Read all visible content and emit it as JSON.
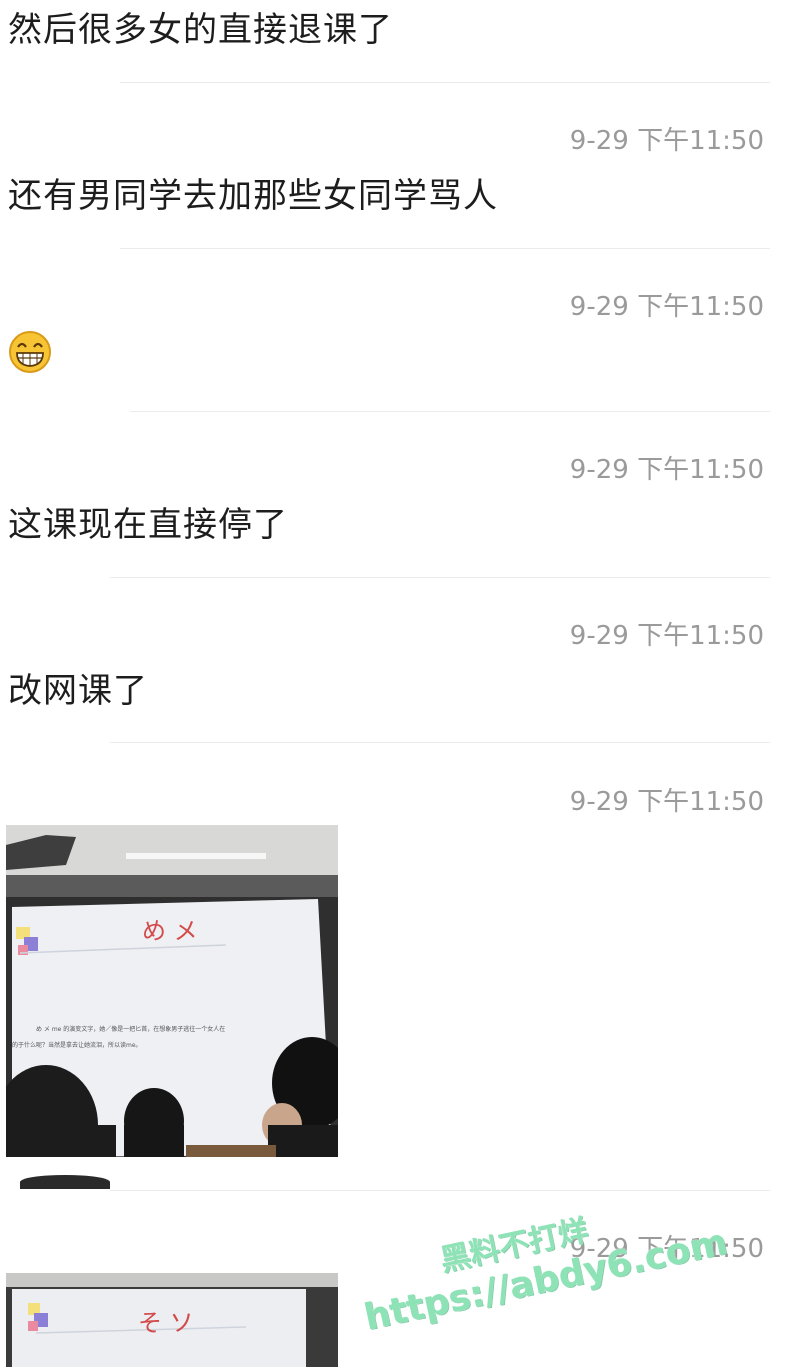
{
  "messages": [
    {
      "text": "然后很多女的直接退课了"
    },
    {
      "timestamp": "9-29 下午11:50",
      "text": "还有男同学去加那些女同学骂人"
    },
    {
      "timestamp": "9-29 下午11:50",
      "emoji": "grinning-face-emoji"
    },
    {
      "timestamp": "9-29 下午11:50",
      "text": "这课现在直接停了"
    },
    {
      "timestamp": "9-29 下午11:50",
      "text": "改网课了"
    },
    {
      "timestamp": "9-29 下午11:50",
      "image": {
        "slide_title": "め メ",
        "slide_body_line1": "め メ me 的演变文字，她／像是一把匕首，在想象男子逃往一个女人在",
        "slide_body_line2": "的于什么呢？当然是拿去让她流泪，所以读me。"
      }
    },
    {
      "timestamp": "9-29 下午11:50",
      "image": {
        "slide_title": "そ ソ"
      }
    }
  ],
  "watermark": {
    "line1": "黑料不打烊",
    "line2": "https://abdy6.com"
  },
  "colors": {
    "text": "#1d1d1d",
    "timestamp": "#9a9a9a",
    "divider": "#ececec",
    "watermark": "#8de3b6"
  }
}
